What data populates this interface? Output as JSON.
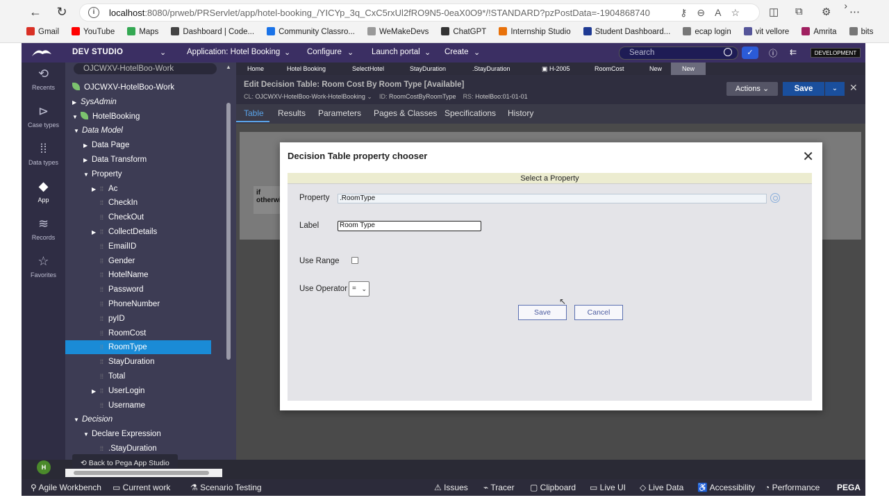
{
  "browser": {
    "url_host": "localhost",
    "url_path": ":8080/prweb/PRServlet/app/hotel-booking_/YICYp_3q_CxC5rxUl2fRO9N5-0eaX0O9*/!STANDARD?pzPostData=-1904868740",
    "bookmarks": [
      {
        "label": "Gmail",
        "color": "#d93025"
      },
      {
        "label": "YouTube",
        "color": "#ff0000"
      },
      {
        "label": "Maps",
        "color": "#34a853"
      },
      {
        "label": "Dashboard | Code...",
        "color": "#444444"
      },
      {
        "label": "Community Classro...",
        "color": "#1a73e8"
      },
      {
        "label": "WeMakeDevs",
        "color": "#999999"
      },
      {
        "label": "ChatGPT",
        "color": "#333333"
      },
      {
        "label": "Internship Studio",
        "color": "#e8710a"
      },
      {
        "label": "Student Dashboard...",
        "color": "#1f3a93"
      },
      {
        "label": "ecap login",
        "color": "#777777"
      },
      {
        "label": "vit vellore",
        "color": "#555599"
      },
      {
        "label": "Amrita",
        "color": "#a02060"
      },
      {
        "label": "bits",
        "color": "#777777"
      }
    ]
  },
  "topbar": {
    "studio": "DEV STUDIO",
    "application": "Application: Hotel Booking",
    "configure": "Configure",
    "launch": "Launch portal",
    "create": "Create",
    "search_placeholder": "Search",
    "mode": "DEVELOPMENT"
  },
  "rail": [
    {
      "label": "Recents",
      "icon": "history-icon"
    },
    {
      "label": "Case types",
      "icon": "case-types-icon"
    },
    {
      "label": "Data types",
      "icon": "data-types-icon"
    },
    {
      "label": "App",
      "icon": "app-cube-icon"
    },
    {
      "label": "Records",
      "icon": "records-icon"
    },
    {
      "label": "Favorites",
      "icon": "star-icon"
    }
  ],
  "avatar": "H",
  "explorer": {
    "class_select": "OJCWXV-HotelBoo-Work",
    "tree": [
      {
        "label": "OJCWXV-HotelBoo-Work",
        "level": 0,
        "arrow": "",
        "leaf": true
      },
      {
        "label": "SysAdmin",
        "level": 1,
        "arrow": "▶",
        "italic": true
      },
      {
        "label": "HotelBooking",
        "level": 1,
        "arrow": "▼",
        "leaf": true
      },
      {
        "label": "Data Model",
        "level": 2,
        "arrow": "▼",
        "italic": true
      },
      {
        "label": "Data Page",
        "level": 3,
        "arrow": "▶"
      },
      {
        "label": "Data Transform",
        "level": 3,
        "arrow": "▶"
      },
      {
        "label": "Property",
        "level": 3,
        "arrow": "▼"
      },
      {
        "label": "Ac",
        "level": 4,
        "arrow": "▶",
        "grip": true
      },
      {
        "label": "CheckIn",
        "level": 4,
        "grip": true
      },
      {
        "label": "CheckOut",
        "level": 4,
        "grip": true
      },
      {
        "label": "CollectDetails",
        "level": 4,
        "arrow": "▶",
        "grip": true
      },
      {
        "label": "EmailID",
        "level": 4,
        "grip": true
      },
      {
        "label": "Gender",
        "level": 4,
        "grip": true
      },
      {
        "label": "HotelName",
        "level": 4,
        "grip": true
      },
      {
        "label": "Password",
        "level": 4,
        "grip": true
      },
      {
        "label": "PhoneNumber",
        "level": 4,
        "grip": true
      },
      {
        "label": "pyID",
        "level": 4,
        "grip": true
      },
      {
        "label": "RoomCost",
        "level": 4,
        "grip": true
      },
      {
        "label": "RoomType",
        "level": 4,
        "grip": true,
        "selected": true
      },
      {
        "label": "StayDuration",
        "level": 4,
        "grip": true
      },
      {
        "label": "Total",
        "level": 4,
        "grip": true
      },
      {
        "label": "UserLogin",
        "level": 4,
        "arrow": "▶",
        "grip": true
      },
      {
        "label": "Username",
        "level": 4,
        "grip": true
      },
      {
        "label": "Decision",
        "level": 2,
        "arrow": "▼",
        "italic": true
      },
      {
        "label": "Declare Expression",
        "level": 3,
        "arrow": "▼"
      },
      {
        "label": ".StayDuration",
        "level": 4,
        "grip": true
      }
    ],
    "back_button": "Back to Pega App Studio"
  },
  "worktabs": [
    "Home",
    "Hotel Booking",
    "SelectHotel",
    "StayDuration",
    ".StayDuration",
    "H-2005",
    "RoomCost",
    "New",
    "New"
  ],
  "edit": {
    "title": "Edit  Decision Table: Room Cost By Room Type [Available]",
    "cl_key": "CL:",
    "cl_val": "OJCWXV-HotelBoo-Work-HotelBooking",
    "id_key": "ID:",
    "id_val": "RoomCostByRoomType",
    "rs_key": "RS:",
    "rs_val": "HotelBoo:01-01-01",
    "actions": "Actions",
    "save": "Save"
  },
  "rule_tabs": [
    "Table",
    "Results",
    "Parameters",
    "Pages & Classes",
    "Specifications",
    "History"
  ],
  "table_bg": {
    "if": "if",
    "otherwise": "otherwi"
  },
  "modal": {
    "title": "Decision Table property chooser",
    "band": "Select a Property",
    "property_label": "Property",
    "property_value": ".RoomType",
    "label_label": "Label",
    "label_value": "Room Type",
    "range_label": "Use Range",
    "operator_label": "Use Operator",
    "operator_value": "=",
    "save": "Save",
    "cancel": "Cancel"
  },
  "footer": {
    "left": [
      "Agile Workbench",
      "Current work",
      "Scenario Testing"
    ],
    "right": [
      "Issues",
      "Tracer",
      "Clipboard",
      "Live UI",
      "Live Data",
      "Accessibility",
      "Performance"
    ],
    "brand": "PEGA"
  }
}
